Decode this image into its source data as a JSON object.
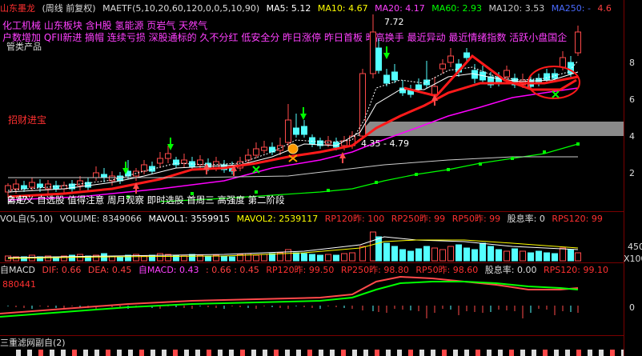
{
  "header": {
    "stock_name": "山东墨龙",
    "period": "(周线 前复权)",
    "indicator": "MAETF(5,10,20,60,120,0,0,5,10,90)",
    "ma5": "MA5: 5.12",
    "ma10": "MA10: 4.67",
    "ma20": "MA20: 4.17",
    "ma60": "MA60: 2.93",
    "ma120": "MA120: 3.53",
    "ma250": "MA250: -",
    "right_val": "4.6"
  },
  "concepts": {
    "line1": "化工机械 山东板块 含H股 氢能源 页岩气 天然气",
    "line2": "户数增加 QFII新进 摘帽 连续亏损 深股通标的 久不分红 低安全分 昨日涨停 昨日首板 昨高换手 最近异动 最近情绪指数 活跃小盘国企",
    "line3": "管类产品"
  },
  "annotations": {
    "red_label": "招财进宝",
    "price_high": "7.72",
    "price_range": "4.35 - 4.79",
    "low_label": "2.47",
    "bottom_tags": "自定义 自选股 值得注意 周月观察 即时选股 首周三 高强度 第二阶段"
  },
  "axis": {
    "main": [
      "8",
      "6",
      "4",
      "2"
    ],
    "vol": [
      "450",
      "X100"
    ],
    "macd": [
      "0"
    ]
  },
  "volume_bar": {
    "title": "VOL自(5,10)",
    "volume": "VOLUME: 8349066",
    "mavol1": "MAVOL1: 3559915",
    "mavol2": "MAVOL2: 2539117",
    "rp120": "RP120昨: 100",
    "rp250": "RP250昨: 99",
    "rp50": "RP50昨: 99",
    "dividend": "股息率: 0",
    "rps120": "RPS120: 99"
  },
  "macd_bar": {
    "title": "自MACD",
    "dif": "DIF: 0.66",
    "dea": "DEA: 0.45",
    "macd": "自MACD: 0.43",
    "vals": ": 0.66 : 0.45",
    "rp120": "RP120昨: 99.50",
    "rp250": "RP250昨: 98.80",
    "rp50": "RP50昨: 98.60",
    "dividend": "股息率: 0.00",
    "rps120": "RPS120: 99.10",
    "code": "880441"
  },
  "bottom_bar": {
    "title": "三重滤网副自(2)"
  },
  "colors": {
    "up": "#ff4a4a",
    "down": "#53ffff",
    "ma5": "#ffffff",
    "ma10": "#ffff00",
    "ma20": "#ff00ff",
    "ma60": "#00ff00",
    "ma120": "#cccccc",
    "thick": "#ff1a1a"
  }
}
